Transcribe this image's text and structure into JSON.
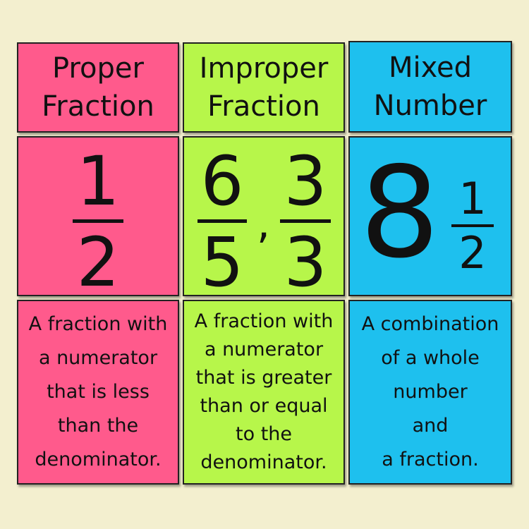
{
  "columns": [
    {
      "color": "#ff5a8c",
      "title": [
        "Proper",
        "Fraction"
      ],
      "example": {
        "numerator": "1",
        "denominator": "2"
      },
      "description": [
        "A fraction with",
        "a numerator",
        "that is less",
        "than the",
        "denominator."
      ]
    },
    {
      "color": "#b7f64a",
      "title": [
        "Improper",
        "Fraction"
      ],
      "example": {
        "first": {
          "numerator": "6",
          "denominator": "5"
        },
        "separator": ",",
        "second": {
          "numerator": "3",
          "denominator": "3"
        }
      },
      "description": [
        "A fraction with",
        "a numerator",
        "that is greater",
        "than or equal",
        "to the",
        "denominator."
      ]
    },
    {
      "color": "#1ec0ee",
      "title": [
        "Mixed",
        "Number"
      ],
      "example": {
        "whole": "8",
        "numerator": "1",
        "denominator": "2"
      },
      "description": [
        "A combination",
        "of a whole",
        "number",
        "and",
        "a fraction."
      ]
    }
  ]
}
